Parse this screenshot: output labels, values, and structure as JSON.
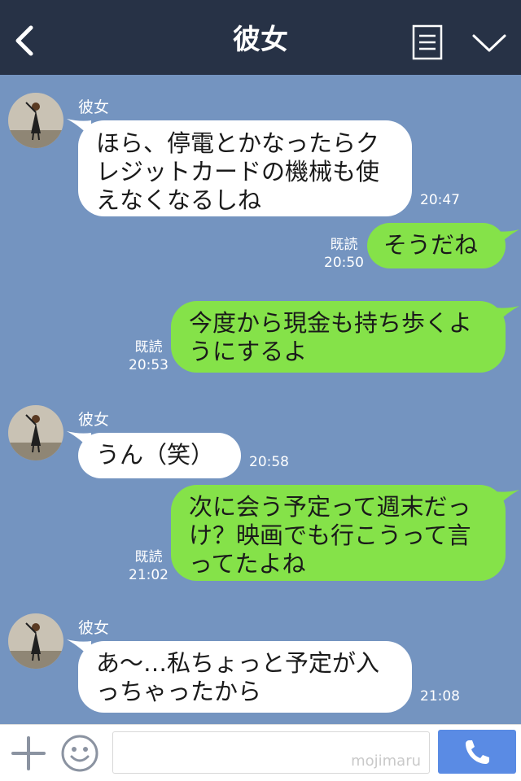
{
  "header": {
    "title": "彼女",
    "back_icon": "chevron-left-icon",
    "menu_icon": "note-menu-icon",
    "expand_icon": "chevron-down-icon"
  },
  "colors": {
    "header_bg": "#273246",
    "chat_bg": "#7494c0",
    "incoming_bubble": "#ffffff",
    "outgoing_bubble": "#85e249",
    "call_button": "#5a8be4"
  },
  "messages": [
    {
      "direction": "incoming",
      "sender": "彼女",
      "lines": [
        "ほら、停電とかなったらク",
        "レジットカードの機械も使",
        "えなくなるしね"
      ],
      "time": "20:47"
    },
    {
      "direction": "outgoing",
      "read": "既読",
      "lines": [
        "そうだね"
      ],
      "time": "20:50"
    },
    {
      "direction": "outgoing",
      "read": "既読",
      "lines": [
        "今度から現金も持ち歩くよ",
        "うにするよ"
      ],
      "time": "20:53"
    },
    {
      "direction": "incoming",
      "sender": "彼女",
      "lines": [
        "うん（笑）"
      ],
      "time": "20:58"
    },
    {
      "direction": "outgoing",
      "read": "既読",
      "lines": [
        "次に会う予定って週末だっ",
        "け？映画でも行こうって言",
        "ってたよね"
      ],
      "time": "21:02"
    },
    {
      "direction": "incoming",
      "sender": "彼女",
      "lines": [
        "あ〜…私ちょっと予定が入",
        "っちゃったから"
      ],
      "time": "21:08"
    }
  ],
  "input_bar": {
    "plus_icon": "plus-icon",
    "emoji_icon": "smiley-icon",
    "text_value": "",
    "watermark": "mojimaru",
    "call_icon": "phone-icon"
  }
}
